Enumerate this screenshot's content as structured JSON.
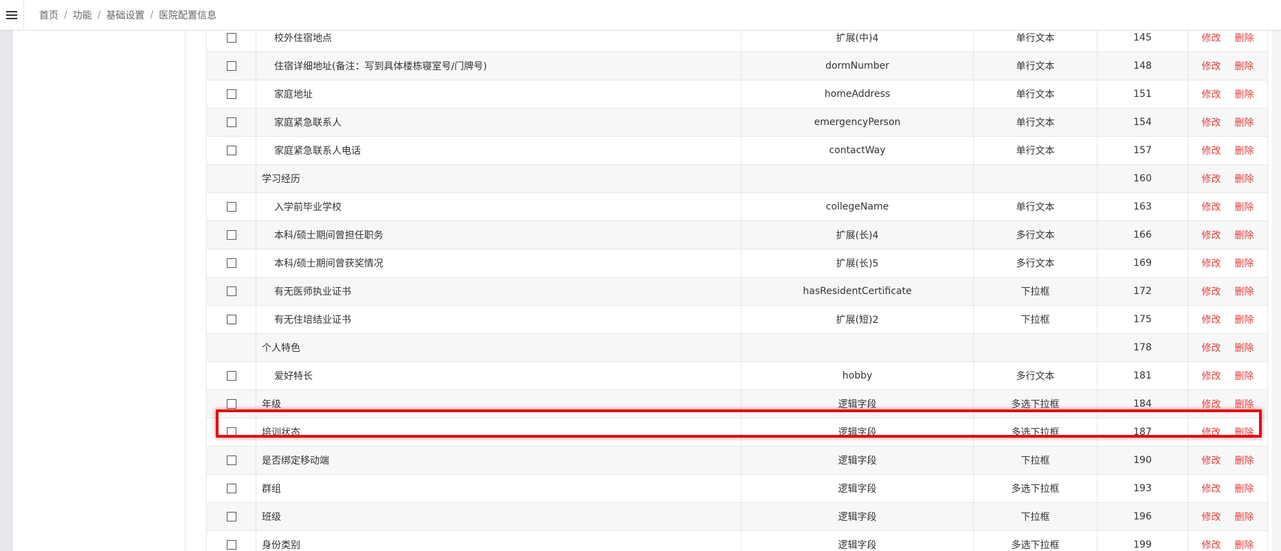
{
  "header": {
    "breadcrumb": [
      "首页",
      "功能",
      "基础设置",
      "医院配置信息"
    ],
    "separator": "/"
  },
  "table": {
    "rows": [
      {
        "checkbox": true,
        "name": "校外住宿地点",
        "indent": true,
        "key": "扩展(中)4",
        "type": "单行文本",
        "order": "145",
        "edit": "修改",
        "delete": "删除"
      },
      {
        "checkbox": true,
        "name": "住宿详细地址(备注：写到具体楼栋寝室号/门牌号)",
        "indent": true,
        "key": "dormNumber",
        "type": "单行文本",
        "order": "148",
        "edit": "修改",
        "delete": "删除"
      },
      {
        "checkbox": true,
        "name": "家庭地址",
        "indent": true,
        "key": "homeAddress",
        "type": "单行文本",
        "order": "151",
        "edit": "修改",
        "delete": "删除"
      },
      {
        "checkbox": true,
        "name": "家庭紧急联系人",
        "indent": true,
        "key": "emergencyPerson",
        "type": "单行文本",
        "order": "154",
        "edit": "修改",
        "delete": "删除"
      },
      {
        "checkbox": true,
        "name": "家庭紧急联系人电话",
        "indent": true,
        "key": "contactWay",
        "type": "单行文本",
        "order": "157",
        "edit": "修改",
        "delete": "删除"
      },
      {
        "checkbox": false,
        "name": "学习经历",
        "indent": false,
        "key": "",
        "type": "",
        "order": "160",
        "edit": "修改",
        "delete": "删除"
      },
      {
        "checkbox": true,
        "name": "入学前毕业学校",
        "indent": true,
        "key": "collegeName",
        "type": "单行文本",
        "order": "163",
        "edit": "修改",
        "delete": "删除"
      },
      {
        "checkbox": true,
        "name": "本科/硕士期间曾担任职务",
        "indent": true,
        "key": "扩展(长)4",
        "type": "多行文本",
        "order": "166",
        "edit": "修改",
        "delete": "删除"
      },
      {
        "checkbox": true,
        "name": "本科/硕士期间曾获奖情况",
        "indent": true,
        "key": "扩展(长)5",
        "type": "多行文本",
        "order": "169",
        "edit": "修改",
        "delete": "删除"
      },
      {
        "checkbox": true,
        "name": "有无医师执业证书",
        "indent": true,
        "key": "hasResidentCertificate",
        "type": "下拉框",
        "order": "172",
        "edit": "修改",
        "delete": "删除"
      },
      {
        "checkbox": true,
        "name": "有无住培结业证书",
        "indent": true,
        "key": "扩展(短)2",
        "type": "下拉框",
        "order": "175",
        "edit": "修改",
        "delete": "删除"
      },
      {
        "checkbox": false,
        "name": "个人特色",
        "indent": false,
        "key": "",
        "type": "",
        "order": "178",
        "edit": "修改",
        "delete": "删除"
      },
      {
        "checkbox": true,
        "name": "爱好特长",
        "indent": true,
        "key": "hobby",
        "type": "多行文本",
        "order": "181",
        "edit": "修改",
        "delete": "删除"
      },
      {
        "checkbox": true,
        "name": "年级",
        "indent": false,
        "key": "逻辑字段",
        "type": "多选下拉框",
        "order": "184",
        "edit": "修改",
        "delete": "删除"
      },
      {
        "checkbox": true,
        "name": "培训状态",
        "indent": false,
        "key": "逻辑字段",
        "type": "多选下拉框",
        "order": "187",
        "edit": "修改",
        "delete": "删除"
      },
      {
        "checkbox": true,
        "name": "是否绑定移动端",
        "indent": false,
        "key": "逻辑字段",
        "type": "下拉框",
        "order": "190",
        "edit": "修改",
        "delete": "删除"
      },
      {
        "checkbox": true,
        "name": "群组",
        "indent": false,
        "key": "逻辑字段",
        "type": "多选下拉框",
        "order": "193",
        "edit": "修改",
        "delete": "删除"
      },
      {
        "checkbox": true,
        "name": "班级",
        "indent": false,
        "key": "逻辑字段",
        "type": "下拉框",
        "order": "196",
        "edit": "修改",
        "delete": "删除"
      },
      {
        "checkbox": true,
        "name": "身份类别",
        "indent": false,
        "key": "逻辑字段",
        "type": "多选下拉框",
        "order": "199",
        "edit": "修改",
        "delete": "删除"
      }
    ]
  },
  "icons": {
    "menu": "hamburger-menu-icon"
  },
  "colors": {
    "action": "#e23d3d",
    "highlight": "#e01010"
  }
}
